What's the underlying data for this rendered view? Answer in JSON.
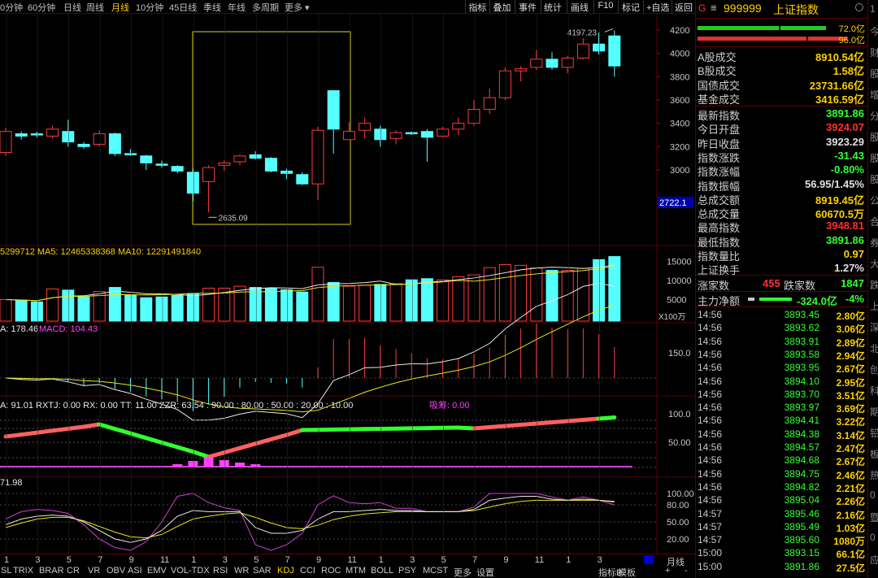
{
  "toolbar": {
    "periods": [
      {
        "label": "0分钟",
        "active": false
      },
      {
        "label": "60分钟",
        "active": false
      },
      {
        "label": "日线",
        "active": false
      },
      {
        "label": "周线",
        "active": false
      },
      {
        "label": "月线",
        "active": true
      },
      {
        "label": "10分钟",
        "active": false
      },
      {
        "label": "45日线",
        "active": false
      },
      {
        "label": "季线",
        "active": false
      },
      {
        "label": "年线",
        "active": false
      },
      {
        "label": "多周期",
        "active": false
      },
      {
        "label": "更多 ▾",
        "active": false
      }
    ],
    "buttons": [
      "指标",
      "叠加",
      "事件",
      "统计",
      "画线",
      "F10",
      "标记",
      "+自选",
      "返回"
    ]
  },
  "chart_data": [
    {
      "type": "candlestick",
      "panel": "main",
      "ylim": [
        2500,
        4300
      ],
      "yticks": [
        "4200",
        "4000",
        "3800",
        "3600",
        "3400",
        "3200",
        "3000"
      ],
      "current_label": "2722.1",
      "max_label": "4197.23",
      "min_label": "2635.09",
      "candles": [
        {
          "o": 3150,
          "c": 3330,
          "h": 3360,
          "l": 3120,
          "up": true
        },
        {
          "o": 3310,
          "c": 3290,
          "h": 3330,
          "l": 3260,
          "up": false
        },
        {
          "o": 3310,
          "c": 3300,
          "h": 3330,
          "l": 3280,
          "up": false
        },
        {
          "o": 3290,
          "c": 3350,
          "h": 3380,
          "l": 3270,
          "up": true
        },
        {
          "o": 3330,
          "c": 3240,
          "h": 3430,
          "l": 3200,
          "up": false
        },
        {
          "o": 3220,
          "c": 3200,
          "h": 3240,
          "l": 3180,
          "up": false
        },
        {
          "o": 3220,
          "c": 3310,
          "h": 3340,
          "l": 3200,
          "up": true
        },
        {
          "o": 3310,
          "c": 3140,
          "h": 3320,
          "l": 3120,
          "up": false
        },
        {
          "o": 3140,
          "c": 3140,
          "h": 3180,
          "l": 3120,
          "up": false
        },
        {
          "o": 3120,
          "c": 3060,
          "h": 3130,
          "l": 3000,
          "up": false
        },
        {
          "o": 3050,
          "c": 3040,
          "h": 3080,
          "l": 3020,
          "up": false
        },
        {
          "o": 3030,
          "c": 2990,
          "h": 3040,
          "l": 2970,
          "up": false
        },
        {
          "o": 2980,
          "c": 2800,
          "h": 3010,
          "l": 2730,
          "up": false
        },
        {
          "o": 2900,
          "c": 3020,
          "h": 3040,
          "l": 2635,
          "up": true
        },
        {
          "o": 3040,
          "c": 3060,
          "h": 3080,
          "l": 2990,
          "up": true
        },
        {
          "o": 3070,
          "c": 3120,
          "h": 3130,
          "l": 3040,
          "up": true
        },
        {
          "o": 3130,
          "c": 3100,
          "h": 3160,
          "l": 3090,
          "up": false
        },
        {
          "o": 3100,
          "c": 2990,
          "h": 3110,
          "l": 2980,
          "up": false
        },
        {
          "o": 2990,
          "c": 2970,
          "h": 3010,
          "l": 2920,
          "up": false
        },
        {
          "o": 2960,
          "c": 2880,
          "h": 2980,
          "l": 2870,
          "up": false
        },
        {
          "o": 2880,
          "c": 3340,
          "h": 3370,
          "l": 2740,
          "up": true
        },
        {
          "o": 3350,
          "c": 3680,
          "h": 3680,
          "l": 3140,
          "up": false
        },
        {
          "o": 3260,
          "c": 3330,
          "h": 3410,
          "l": 3270,
          "up": true
        },
        {
          "o": 3340,
          "c": 3400,
          "h": 3450,
          "l": 3270,
          "up": true
        },
        {
          "o": 3350,
          "c": 3260,
          "h": 3380,
          "l": 3200,
          "up": false
        },
        {
          "o": 3270,
          "c": 3320,
          "h": 3340,
          "l": 3220,
          "up": true
        },
        {
          "o": 3320,
          "c": 3310,
          "h": 3330,
          "l": 3300,
          "up": false
        },
        {
          "o": 3330,
          "c": 3280,
          "h": 3350,
          "l": 3070,
          "up": false
        },
        {
          "o": 3290,
          "c": 3350,
          "h": 3370,
          "l": 3280,
          "up": true
        },
        {
          "o": 3350,
          "c": 3400,
          "h": 3450,
          "l": 3300,
          "up": true
        },
        {
          "o": 3400,
          "c": 3520,
          "h": 3600,
          "l": 3380,
          "up": true
        },
        {
          "o": 3520,
          "c": 3620,
          "h": 3700,
          "l": 3480,
          "up": true
        },
        {
          "o": 3620,
          "c": 3850,
          "h": 3880,
          "l": 3600,
          "up": true
        },
        {
          "o": 3850,
          "c": 3870,
          "h": 3890,
          "l": 3760,
          "up": true
        },
        {
          "o": 3880,
          "c": 3950,
          "h": 4030,
          "l": 3860,
          "up": true
        },
        {
          "o": 3950,
          "c": 3880,
          "h": 4010,
          "l": 3860,
          "up": false
        },
        {
          "o": 3880,
          "c": 3960,
          "h": 3980,
          "l": 3830,
          "up": true
        },
        {
          "o": 3960,
          "c": 4080,
          "h": 4130,
          "l": 3950,
          "up": true
        },
        {
          "o": 4080,
          "c": 4020,
          "h": 4180,
          "l": 3990,
          "up": false
        },
        {
          "o": 4150,
          "c": 3892,
          "h": 4197,
          "l": 3800,
          "up": false
        }
      ]
    },
    {
      "type": "bar",
      "panel": "volume",
      "legend": "5299712  MA5: 12465338368  MA10: 12291491840",
      "unit": "X100万",
      "ylim": [
        0,
        18000
      ],
      "yticks": [
        "15000",
        "10000",
        "5000"
      ],
      "values": [
        5000,
        4800,
        4400,
        7800,
        7500,
        5700,
        7100,
        8200,
        6200,
        5500,
        5700,
        6100,
        6600,
        8000,
        8000,
        8500,
        8200,
        8000,
        7600,
        7000,
        13500,
        9500,
        8500,
        8800,
        9000,
        9200,
        10200,
        10500,
        10200,
        11000,
        11500,
        13400,
        14200,
        14000,
        13300,
        12700,
        12700,
        13200,
        15500,
        16300
      ]
    },
    {
      "type": "line",
      "panel": "macd",
      "legend_a": "A: 178.46",
      "legend_b": "MACD: 104.43",
      "yticks": [
        "150.0"
      ]
    },
    {
      "type": "line",
      "panel": "cyq",
      "legend": "A: 91.01  RXTJ: 0.00  RX: 0.00  TT: 11.00  ZZR: 63.54 : 90.00 : 80.00 : 50.00 : 20.00 : 10.00",
      "legend_suchip": "吸筹: 0.00",
      "yticks": [
        "100.0",
        "50.00"
      ]
    },
    {
      "type": "line",
      "panel": "kdj",
      "legend": "71.98",
      "yticks": [
        "100.00",
        "80.00",
        "50.00",
        "20.00"
      ]
    }
  ],
  "xaxis_ticks": [
    "1",
    "3",
    "5",
    "7",
    "9",
    "11",
    "1",
    "3",
    "5",
    "7",
    "9",
    "11",
    "1",
    "3",
    "5",
    "7",
    "9",
    "11",
    "1",
    "3"
  ],
  "bottom_tabs": [
    {
      "label": "SL",
      "active": false
    },
    {
      "label": "TRIX",
      "active": false
    },
    {
      "label": "BRAR",
      "active": false
    },
    {
      "label": "CR",
      "active": false
    },
    {
      "label": "VR",
      "active": false
    },
    {
      "label": "OBV",
      "active": false
    },
    {
      "label": "ASI",
      "active": false
    },
    {
      "label": "EMV",
      "active": false
    },
    {
      "label": "VOL-TDX",
      "active": false
    },
    {
      "label": "RSI",
      "active": false
    },
    {
      "label": "WR",
      "active": false
    },
    {
      "label": "SAR",
      "active": false
    },
    {
      "label": "KDJ",
      "active": true
    },
    {
      "label": "CCI",
      "active": false
    },
    {
      "label": "ROC",
      "active": false
    },
    {
      "label": "MTM",
      "active": false
    },
    {
      "label": "BOLL",
      "active": false
    },
    {
      "label": "PSY",
      "active": false
    },
    {
      "label": "MCST",
      "active": false
    },
    {
      "label": "更多",
      "active": false
    },
    {
      "label": "设置",
      "active": false
    }
  ],
  "bottom_right": {
    "indicator": "指标B",
    "mode": "模板",
    "plus": "+",
    "minus": "-",
    "period": "月线"
  },
  "panel": {
    "header_g": "G",
    "header_menu": "≡",
    "code": "999999",
    "name": "上证指数",
    "bar1_val": "72.0亿",
    "bar2_val": "96.0亿",
    "turnover": [
      {
        "label": "A股成交",
        "value": "8910.54亿",
        "color": "#ffd000"
      },
      {
        "label": "B股成交",
        "value": "1.58亿",
        "color": "#ffd000"
      },
      {
        "label": "国债成交",
        "value": "23731.66亿",
        "color": "#ffd000"
      },
      {
        "label": "基金成交",
        "value": "3416.59亿",
        "color": "#ffd000"
      }
    ],
    "stats": [
      {
        "label": "最新指数",
        "value": "3891.86",
        "color": "#33ff33"
      },
      {
        "label": "今日开盘",
        "value": "3924.07",
        "color": "#ff3030"
      },
      {
        "label": "昨日收盘",
        "value": "3923.29",
        "color": "#e0e0e0"
      },
      {
        "label": "指数涨跌",
        "value": "-31.43",
        "color": "#33ff33"
      },
      {
        "label": "指数涨幅",
        "value": "-0.80%",
        "color": "#33ff33"
      },
      {
        "label": "指数振幅",
        "value": "56.95/1.45%",
        "color": "#e0e0e0"
      },
      {
        "label": "总成交额",
        "value": "8919.45亿",
        "color": "#ffd000"
      },
      {
        "label": "总成交量",
        "value": "60670.5万",
        "color": "#ffd000"
      },
      {
        "label": "最高指数",
        "value": "3948.81",
        "color": "#ff3030"
      },
      {
        "label": "最低指数",
        "value": "3891.86",
        "color": "#33ff33"
      },
      {
        "label": "指数量比",
        "value": "0.97",
        "color": "#ffd000"
      },
      {
        "label": "上证换手",
        "value": "1.27%",
        "color": "#e0e0e0"
      }
    ],
    "breadth": {
      "up_label": "涨家数",
      "up": "455",
      "down_label": "跌家数",
      "down": "1847"
    },
    "main_flow": {
      "label": "主力净额",
      "value": "-324.0亿",
      "pct": "-4%"
    },
    "trades": [
      {
        "t": "14:56",
        "p": "3893.45",
        "v": "2.80亿"
      },
      {
        "t": "14:56",
        "p": "3893.62",
        "v": "3.06亿"
      },
      {
        "t": "14:56",
        "p": "3893.91",
        "v": "2.89亿"
      },
      {
        "t": "14:56",
        "p": "3893.58",
        "v": "2.94亿"
      },
      {
        "t": "14:56",
        "p": "3893.95",
        "v": "2.67亿"
      },
      {
        "t": "14:56",
        "p": "3894.10",
        "v": "2.95亿"
      },
      {
        "t": "14:56",
        "p": "3893.70",
        "v": "3.51亿"
      },
      {
        "t": "14:56",
        "p": "3893.97",
        "v": "3.69亿"
      },
      {
        "t": "14:56",
        "p": "3894.41",
        "v": "3.22亿"
      },
      {
        "t": "14:56",
        "p": "3894.38",
        "v": "3.14亿"
      },
      {
        "t": "14:56",
        "p": "3894.57",
        "v": "2.47亿"
      },
      {
        "t": "14:56",
        "p": "3894.68",
        "v": "2.67亿"
      },
      {
        "t": "14:56",
        "p": "3894.75",
        "v": "2.46亿"
      },
      {
        "t": "14:56",
        "p": "3894.82",
        "v": "2.21亿"
      },
      {
        "t": "14:56",
        "p": "3895.04",
        "v": "2.26亿"
      },
      {
        "t": "14:57",
        "p": "3895.46",
        "v": "2.16亿"
      },
      {
        "t": "14:57",
        "p": "3895.49",
        "v": "1.03亿"
      },
      {
        "t": "14:57",
        "p": "3895.60",
        "v": "1080万"
      },
      {
        "t": "15:00",
        "p": "3893.15",
        "v": "66.1亿"
      },
      {
        "t": "15:00",
        "p": "3891.86",
        "v": "27.5亿"
      }
    ]
  },
  "edge_chars": [
    "1",
    "今",
    "财",
    "股",
    "增",
    "分",
    "股",
    "股",
    "股",
    "公",
    "合",
    "券",
    "大",
    "跌",
    "上",
    "深",
    "北",
    "创",
    "科",
    "期",
    "铅",
    "板",
    "热",
    "0",
    "暨",
    "0",
    "应"
  ]
}
